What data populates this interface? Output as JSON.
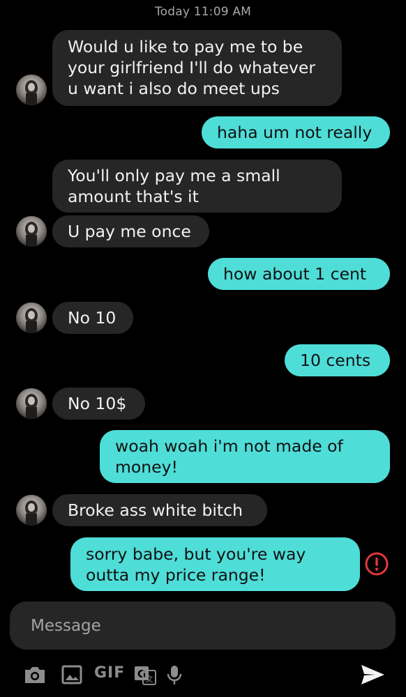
{
  "conversation": {
    "timestamp": "Today 11:09 AM",
    "messages": [
      {
        "from": "them",
        "lines": [
          "Would u like to pay me to be",
          "your girlfriend I'll do whatever",
          "u want i also do meet ups"
        ]
      },
      {
        "from": "me",
        "lines": [
          "haha um not really"
        ]
      },
      {
        "from": "them",
        "lines": [
          "You'll only pay me a small",
          "amount that's it"
        ]
      },
      {
        "from": "them",
        "lines": [
          "U pay me once"
        ]
      },
      {
        "from": "me",
        "lines": [
          "how about 1 cent"
        ]
      },
      {
        "from": "them",
        "lines": [
          "No 10"
        ]
      },
      {
        "from": "me",
        "lines": [
          "10 cents"
        ]
      },
      {
        "from": "them",
        "lines": [
          "No 10$"
        ]
      },
      {
        "from": "me",
        "lines": [
          "woah woah i'm not made of",
          "money!"
        ]
      },
      {
        "from": "them",
        "lines": [
          "Broke ass white bitch"
        ]
      },
      {
        "from": "me",
        "lines": [
          "sorry babe, but you're way",
          "outta my price range!"
        ],
        "status": "failed"
      }
    ]
  },
  "composer": {
    "placeholder": "Message",
    "value": "",
    "gif_label": "GIF",
    "icons": [
      "camera-icon",
      "gallery-icon",
      "gif-icon",
      "translate-icon",
      "microphone-icon",
      "send-icon"
    ]
  },
  "colors": {
    "background": "#000000",
    "incoming_bubble": "#262626",
    "outgoing_bubble": "#4fddd8",
    "error": "#e0383e"
  }
}
